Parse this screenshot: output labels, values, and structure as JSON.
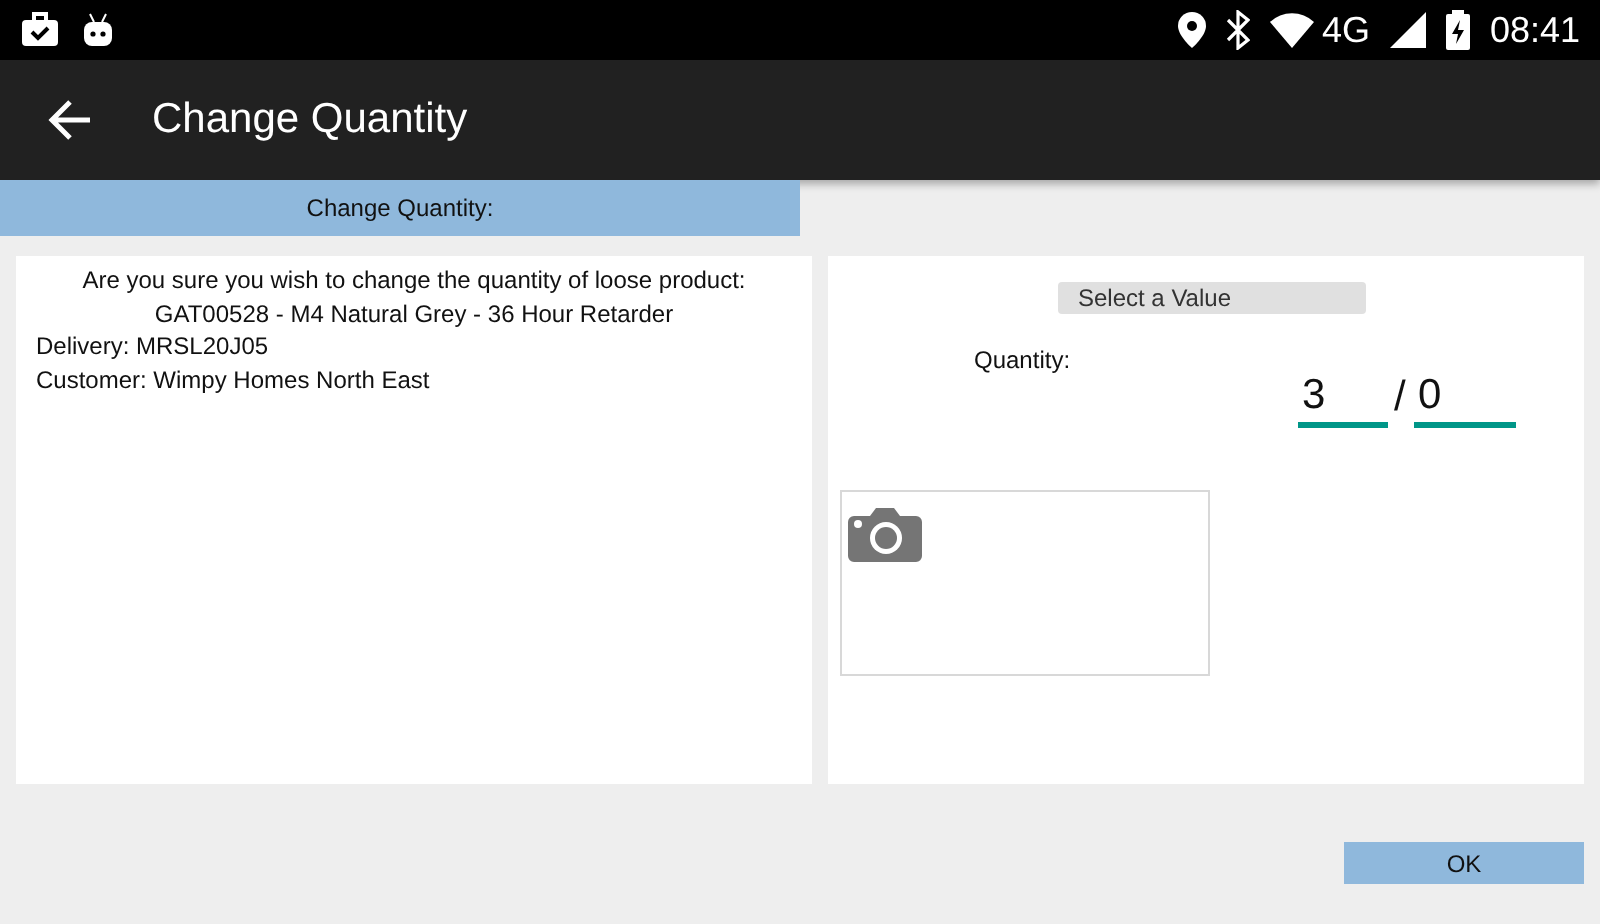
{
  "status_bar": {
    "network": "4G",
    "time": "08:41"
  },
  "toolbar": {
    "title": "Change Quantity"
  },
  "section_header": "Change Quantity:",
  "details": {
    "question": "Are you sure you wish to change the quantity of loose product:",
    "product": "GAT00528 - M4 Natural Grey - 36 Hour Retarder",
    "delivery": "Delivery: MRSL20J05",
    "customer": "Customer: Wimpy Homes North East"
  },
  "quantity": {
    "select_button": "Select a Value",
    "label": "Quantity:",
    "value": "3",
    "separator": "/",
    "second_value": "0"
  },
  "buttons": [
    "OK"
  ]
}
